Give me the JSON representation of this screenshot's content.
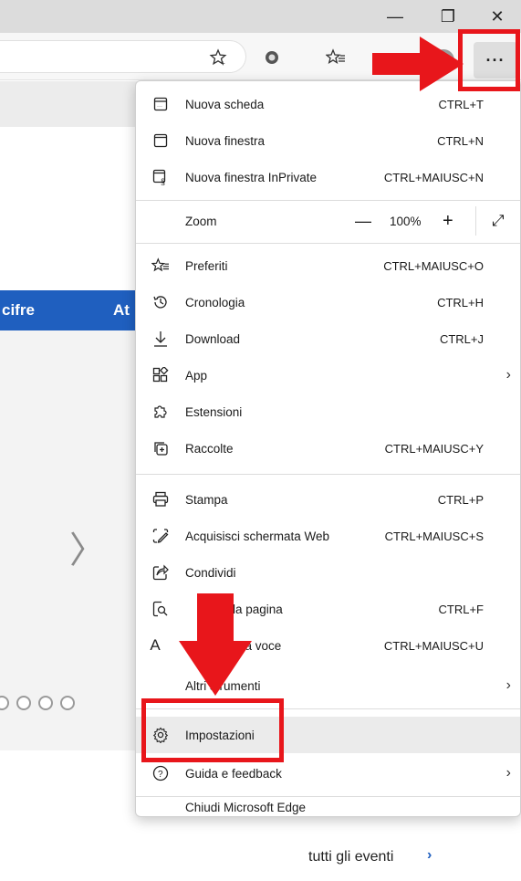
{
  "window": {
    "minimize_icon": "minimize-icon",
    "maximize_icon": "restore-icon",
    "close_icon": "close-icon",
    "minimize_glyph": "—",
    "maximize_glyph": "❐",
    "close_glyph": "✕"
  },
  "toolbar": {
    "more_label": "···",
    "icons": [
      "add-favorite-icon",
      "tracking-icon",
      "favorites-icon",
      "profile-icon"
    ]
  },
  "page": {
    "nav_left": "cifre",
    "nav_right": "At",
    "events_link": "tutti gli eventi",
    "events_chevron": "›",
    "carousel_chevron": "〉"
  },
  "menu": {
    "items": [
      {
        "label": "Nuova scheda",
        "shortcut": "CTRL+T",
        "icon": "new-tab-icon"
      },
      {
        "label": "Nuova finestra",
        "shortcut": "CTRL+N",
        "icon": "new-window-icon"
      },
      {
        "label": "Nuova finestra InPrivate",
        "shortcut": "CTRL+MAIUSC+N",
        "icon": "inprivate-icon"
      },
      {
        "label": "Preferiti",
        "shortcut": "CTRL+MAIUSC+O",
        "icon": "favorites-icon"
      },
      {
        "label": "Cronologia",
        "shortcut": "CTRL+H",
        "icon": "history-icon"
      },
      {
        "label": "Download",
        "shortcut": "CTRL+J",
        "icon": "download-icon"
      },
      {
        "label": "App",
        "shortcut": "",
        "icon": "apps-icon",
        "submenu": true
      },
      {
        "label": "Estensioni",
        "shortcut": "",
        "icon": "extensions-icon"
      },
      {
        "label": "Raccolte",
        "shortcut": "CTRL+MAIUSC+Y",
        "icon": "collections-icon"
      },
      {
        "label": "Stampa",
        "shortcut": "CTRL+P",
        "icon": "print-icon"
      },
      {
        "label": "Acquisisci schermata Web",
        "shortcut": "CTRL+MAIUSC+S",
        "icon": "web-capture-icon"
      },
      {
        "label": "Condividi",
        "shortcut": "",
        "icon": "share-icon"
      },
      {
        "label": "nella pagina",
        "shortcut": "CTRL+F",
        "icon": "find-icon"
      },
      {
        "label": "d alta voce",
        "shortcut": "CTRL+MAIUSC+U",
        "icon": "read-aloud-icon"
      },
      {
        "label": "Altri strumenti",
        "shortcut": "",
        "icon": "",
        "submenu": true
      },
      {
        "label": "Impostazioni",
        "shortcut": "",
        "icon": "settings-icon",
        "highlighted": true
      },
      {
        "label": "Guida e feedback",
        "shortcut": "",
        "icon": "help-icon",
        "submenu": true
      },
      {
        "label": "Chiudi Microsoft Edge",
        "shortcut": "",
        "icon": ""
      }
    ],
    "zoom": {
      "label": "Zoom",
      "value": "100%",
      "minus": "—",
      "plus": "+",
      "fullscreen": "⤢"
    },
    "submenu_arrow": "›"
  },
  "colors": {
    "annotation_red": "#e8161b",
    "nav_blue": "#1f5fbf",
    "highlight": "#ebebeb"
  }
}
